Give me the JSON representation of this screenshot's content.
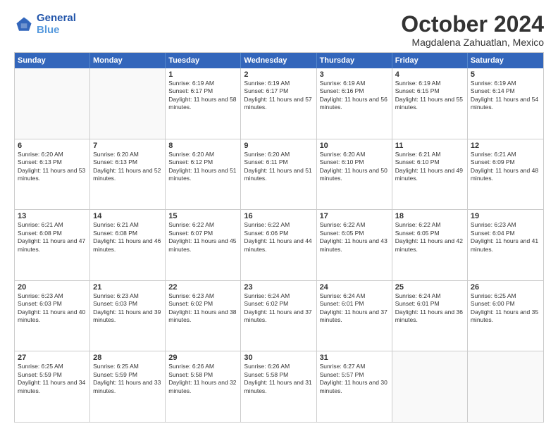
{
  "logo": {
    "line1": "General",
    "line2": "Blue"
  },
  "title": "October 2024",
  "location": "Magdalena Zahuatlan, Mexico",
  "header_days": [
    "Sunday",
    "Monday",
    "Tuesday",
    "Wednesday",
    "Thursday",
    "Friday",
    "Saturday"
  ],
  "rows": [
    [
      {
        "day": "",
        "text": ""
      },
      {
        "day": "",
        "text": ""
      },
      {
        "day": "1",
        "text": "Sunrise: 6:19 AM\nSunset: 6:17 PM\nDaylight: 11 hours and 58 minutes."
      },
      {
        "day": "2",
        "text": "Sunrise: 6:19 AM\nSunset: 6:17 PM\nDaylight: 11 hours and 57 minutes."
      },
      {
        "day": "3",
        "text": "Sunrise: 6:19 AM\nSunset: 6:16 PM\nDaylight: 11 hours and 56 minutes."
      },
      {
        "day": "4",
        "text": "Sunrise: 6:19 AM\nSunset: 6:15 PM\nDaylight: 11 hours and 55 minutes."
      },
      {
        "day": "5",
        "text": "Sunrise: 6:19 AM\nSunset: 6:14 PM\nDaylight: 11 hours and 54 minutes."
      }
    ],
    [
      {
        "day": "6",
        "text": "Sunrise: 6:20 AM\nSunset: 6:13 PM\nDaylight: 11 hours and 53 minutes."
      },
      {
        "day": "7",
        "text": "Sunrise: 6:20 AM\nSunset: 6:13 PM\nDaylight: 11 hours and 52 minutes."
      },
      {
        "day": "8",
        "text": "Sunrise: 6:20 AM\nSunset: 6:12 PM\nDaylight: 11 hours and 51 minutes."
      },
      {
        "day": "9",
        "text": "Sunrise: 6:20 AM\nSunset: 6:11 PM\nDaylight: 11 hours and 51 minutes."
      },
      {
        "day": "10",
        "text": "Sunrise: 6:20 AM\nSunset: 6:10 PM\nDaylight: 11 hours and 50 minutes."
      },
      {
        "day": "11",
        "text": "Sunrise: 6:21 AM\nSunset: 6:10 PM\nDaylight: 11 hours and 49 minutes."
      },
      {
        "day": "12",
        "text": "Sunrise: 6:21 AM\nSunset: 6:09 PM\nDaylight: 11 hours and 48 minutes."
      }
    ],
    [
      {
        "day": "13",
        "text": "Sunrise: 6:21 AM\nSunset: 6:08 PM\nDaylight: 11 hours and 47 minutes."
      },
      {
        "day": "14",
        "text": "Sunrise: 6:21 AM\nSunset: 6:08 PM\nDaylight: 11 hours and 46 minutes."
      },
      {
        "day": "15",
        "text": "Sunrise: 6:22 AM\nSunset: 6:07 PM\nDaylight: 11 hours and 45 minutes."
      },
      {
        "day": "16",
        "text": "Sunrise: 6:22 AM\nSunset: 6:06 PM\nDaylight: 11 hours and 44 minutes."
      },
      {
        "day": "17",
        "text": "Sunrise: 6:22 AM\nSunset: 6:05 PM\nDaylight: 11 hours and 43 minutes."
      },
      {
        "day": "18",
        "text": "Sunrise: 6:22 AM\nSunset: 6:05 PM\nDaylight: 11 hours and 42 minutes."
      },
      {
        "day": "19",
        "text": "Sunrise: 6:23 AM\nSunset: 6:04 PM\nDaylight: 11 hours and 41 minutes."
      }
    ],
    [
      {
        "day": "20",
        "text": "Sunrise: 6:23 AM\nSunset: 6:03 PM\nDaylight: 11 hours and 40 minutes."
      },
      {
        "day": "21",
        "text": "Sunrise: 6:23 AM\nSunset: 6:03 PM\nDaylight: 11 hours and 39 minutes."
      },
      {
        "day": "22",
        "text": "Sunrise: 6:23 AM\nSunset: 6:02 PM\nDaylight: 11 hours and 38 minutes."
      },
      {
        "day": "23",
        "text": "Sunrise: 6:24 AM\nSunset: 6:02 PM\nDaylight: 11 hours and 37 minutes."
      },
      {
        "day": "24",
        "text": "Sunrise: 6:24 AM\nSunset: 6:01 PM\nDaylight: 11 hours and 37 minutes."
      },
      {
        "day": "25",
        "text": "Sunrise: 6:24 AM\nSunset: 6:01 PM\nDaylight: 11 hours and 36 minutes."
      },
      {
        "day": "26",
        "text": "Sunrise: 6:25 AM\nSunset: 6:00 PM\nDaylight: 11 hours and 35 minutes."
      }
    ],
    [
      {
        "day": "27",
        "text": "Sunrise: 6:25 AM\nSunset: 5:59 PM\nDaylight: 11 hours and 34 minutes."
      },
      {
        "day": "28",
        "text": "Sunrise: 6:25 AM\nSunset: 5:59 PM\nDaylight: 11 hours and 33 minutes."
      },
      {
        "day": "29",
        "text": "Sunrise: 6:26 AM\nSunset: 5:58 PM\nDaylight: 11 hours and 32 minutes."
      },
      {
        "day": "30",
        "text": "Sunrise: 6:26 AM\nSunset: 5:58 PM\nDaylight: 11 hours and 31 minutes."
      },
      {
        "day": "31",
        "text": "Sunrise: 6:27 AM\nSunset: 5:57 PM\nDaylight: 11 hours and 30 minutes."
      },
      {
        "day": "",
        "text": ""
      },
      {
        "day": "",
        "text": ""
      }
    ]
  ]
}
